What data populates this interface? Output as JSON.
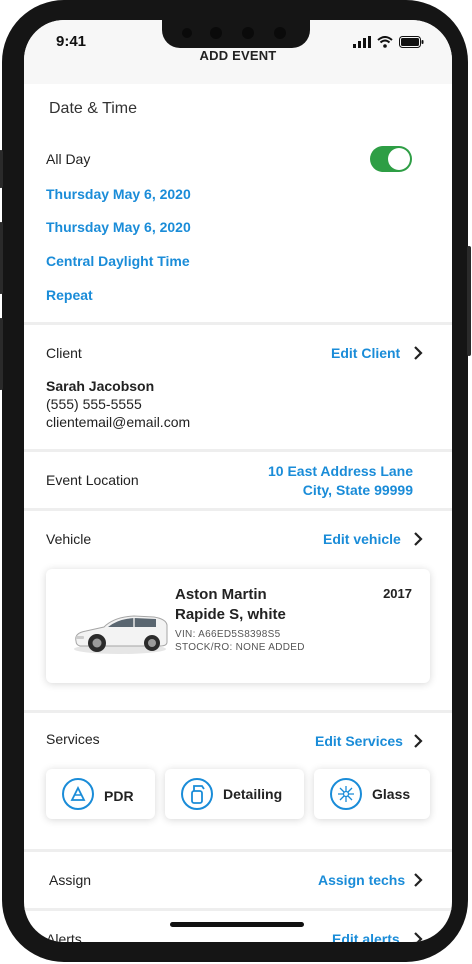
{
  "status_bar": {
    "time": "9:41"
  },
  "nav": {
    "title": "ADD EVENT"
  },
  "date_time": {
    "section_title": "Date & Time",
    "all_day_label": "All Day",
    "all_day_on": true,
    "start_date": "Thursday May 6, 2020",
    "end_date": "Thursday May 6, 2020",
    "timezone": "Central Daylight Time",
    "repeat": "Repeat"
  },
  "client": {
    "section_title": "Client",
    "edit_label": "Edit Client",
    "name": "Sarah Jacobson",
    "phone": "(555) 555-5555",
    "email": "clientemail@email.com"
  },
  "location": {
    "section_title": "Event Location",
    "address_line1": "10 East Address Lane",
    "address_line2": "City, State 99999"
  },
  "vehicle": {
    "section_title": "Vehicle",
    "edit_label": "Edit vehicle",
    "make": "Aston Martin",
    "model": "Rapide S, white",
    "year": "2017",
    "vin": "VIN: A66ED5S8398S5",
    "stock": "STOCK/RO: NONE ADDED"
  },
  "services": {
    "section_title": "Services",
    "edit_label": "Edit Services",
    "items": [
      {
        "label": "PDR",
        "icon": "pdr-icon"
      },
      {
        "label": "Detailing",
        "icon": "spray-bottle-icon"
      },
      {
        "label": "Glass",
        "icon": "glass-crack-icon"
      }
    ]
  },
  "assign": {
    "section_title": "Assign",
    "action_label": "Assign techs"
  },
  "alerts": {
    "section_title": "Alerts",
    "edit_label": "Edit alerts"
  },
  "colors": {
    "accent": "#1a8cd8",
    "toggle_on": "#2e9e45",
    "divider": "#eeeeee"
  }
}
